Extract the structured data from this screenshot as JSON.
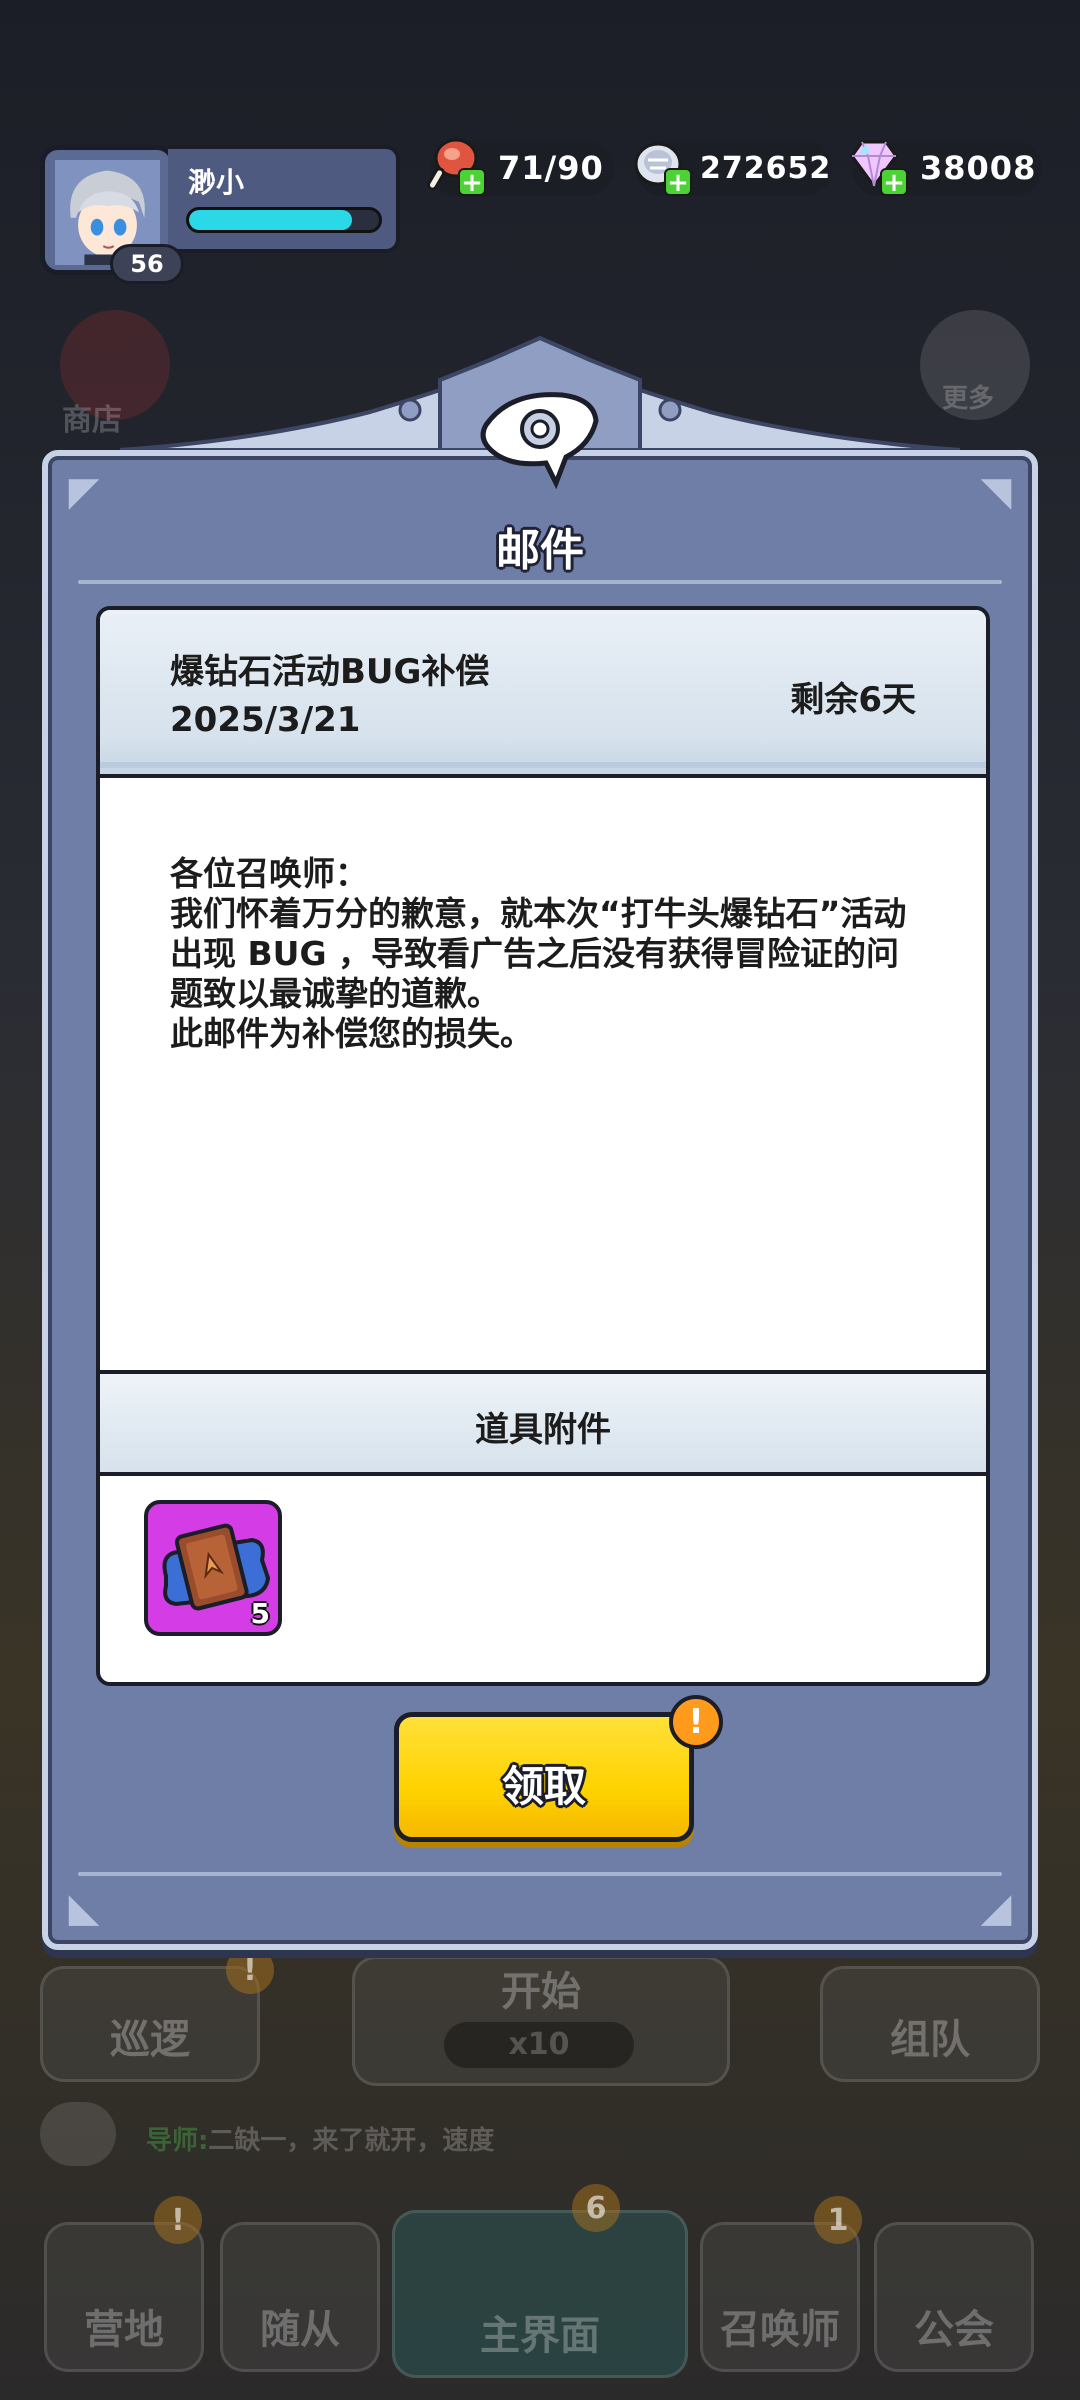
{
  "player": {
    "name": "渺小",
    "level": "56",
    "hp_fraction": 0.86
  },
  "resources": [
    {
      "name": "stamina",
      "icon": "meat-icon",
      "value": "71/90"
    },
    {
      "name": "coins",
      "icon": "silver-coins-icon",
      "value": "272652"
    },
    {
      "name": "diamonds",
      "icon": "diamond-icon",
      "value": "38008"
    }
  ],
  "background": {
    "shop": "商店",
    "more": "更多",
    "patrol": "巡逻",
    "start": "开始",
    "start_cost": "x10",
    "team": "组队",
    "chat_sender": "导师:",
    "chat_text": "二缺一，来了就开，速度",
    "nav": [
      "营地",
      "随从",
      "主界面",
      "召唤师",
      "公会"
    ],
    "nav_badges": {
      "camp": "!",
      "main": "6",
      "summoner": "1"
    }
  },
  "dialog": {
    "title": "邮件",
    "mail": {
      "subject": "爆钻石活动BUG补偿",
      "date": "2025/3/21",
      "remaining": "剩余6天",
      "body": [
        "各位召唤师：",
        "我们怀着万分的歉意，就本次“打牛头爆钻石”活动出现 BUG ，导致看广告之后没有获得冒险证的问题致以最诚挚的道歉。",
        "此邮件为补偿您的损失。"
      ]
    },
    "attachments_label": "道具附件",
    "attachments": [
      {
        "icon": "adventure-ticket-icon",
        "count": "5"
      }
    ],
    "claim_label": "领取",
    "claim_badge": "!"
  },
  "colors": {
    "dialog_bg": "#6e7ea6",
    "claim_button": "#ffd300",
    "item_rarity": "#d43de6",
    "hp_bar": "#2ad8e8"
  }
}
